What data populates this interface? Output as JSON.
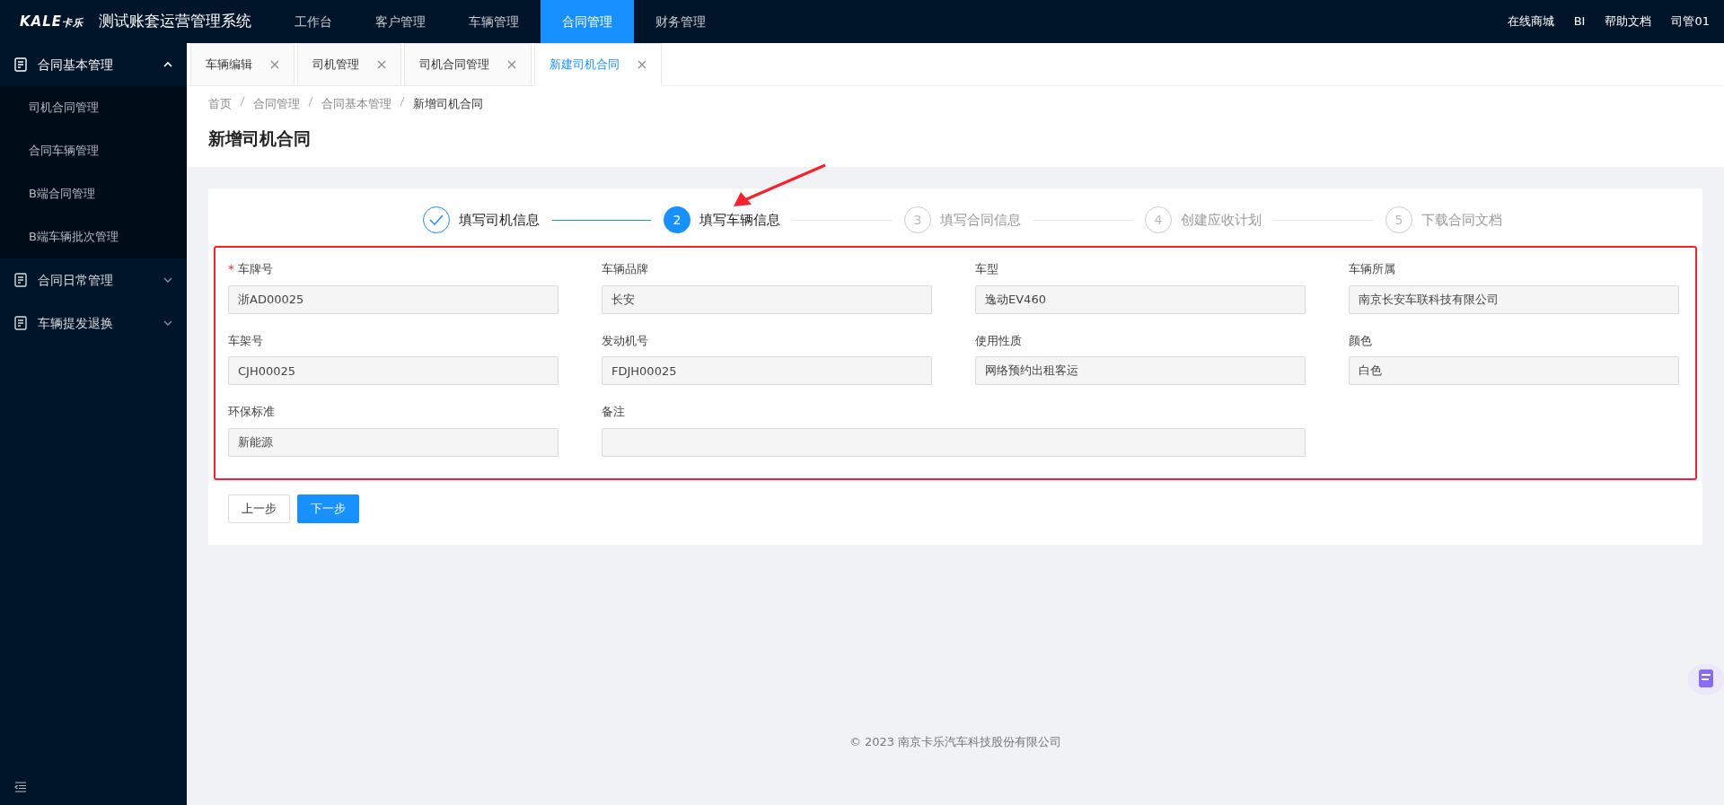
{
  "header": {
    "logo": {
      "latin": "KALE",
      "cjk": "卡乐"
    },
    "title": "测试账套运营管理系统",
    "nav": [
      {
        "label": "工作台",
        "selected": false
      },
      {
        "label": "客户管理",
        "selected": false
      },
      {
        "label": "车辆管理",
        "selected": false
      },
      {
        "label": "合同管理",
        "selected": true
      },
      {
        "label": "财务管理",
        "selected": false
      }
    ],
    "links": [
      "在线商城",
      "BI",
      "帮助文档",
      "司管01"
    ]
  },
  "sidebar": {
    "groups": [
      {
        "label": "合同基本管理",
        "expanded": true,
        "items": [
          {
            "label": "司机合同管理"
          },
          {
            "label": "合同车辆管理"
          },
          {
            "label": "B端合同管理"
          },
          {
            "label": "B端车辆批次管理"
          }
        ]
      },
      {
        "label": "合同日常管理",
        "expanded": false
      },
      {
        "label": "车辆提发退换",
        "expanded": false
      }
    ]
  },
  "tabs": [
    {
      "label": "车辆编辑",
      "selected": false
    },
    {
      "label": "司机管理",
      "selected": false
    },
    {
      "label": "司机合同管理",
      "selected": false
    },
    {
      "label": "新建司机合同",
      "selected": true
    }
  ],
  "breadcrumb": [
    "首页",
    "合同管理",
    "合同基本管理",
    "新增司机合同"
  ],
  "page_title": "新增司机合同",
  "steps": [
    {
      "label": "填写司机信息",
      "done": true,
      "selected": false
    },
    {
      "number": "2",
      "label": "填写车辆信息",
      "done": false,
      "selected": true
    },
    {
      "number": "3",
      "label": "填写合同信息",
      "done": false,
      "selected": false
    },
    {
      "number": "4",
      "label": "创建应收计划",
      "done": false,
      "selected": false
    },
    {
      "number": "5",
      "label": "下载合同文档",
      "done": false,
      "selected": false
    }
  ],
  "fields": [
    {
      "kind": "short",
      "marker": "*",
      "label": "车牌号",
      "value": "浙AD00025"
    },
    {
      "kind": "short",
      "label": "车辆品牌",
      "value": "长安"
    },
    {
      "kind": "short",
      "label": "车型",
      "value": "逸动EV460"
    },
    {
      "kind": "short",
      "label": "车辆所属",
      "value": "南京长安车联科技有限公司"
    },
    {
      "kind": "short",
      "label": "车架号",
      "value": "CJH00025"
    },
    {
      "kind": "short",
      "label": "发动机号",
      "value": "FDJH00025"
    },
    {
      "kind": "short",
      "label": "使用性质",
      "value": "网络预约出租客运"
    },
    {
      "kind": "short",
      "label": "颜色",
      "value": "白色"
    },
    {
      "kind": "short",
      "label": "环保标准",
      "value": "新能源"
    },
    {
      "kind": "long",
      "label": "备注"
    }
  ],
  "buttons": [
    {
      "label": "上一步",
      "kind": "default"
    },
    {
      "label": "下一步",
      "kind": "primary"
    }
  ],
  "footer": {
    "symbol": "©",
    "text": "2023 南京卡乐汽车科技股份有限公司"
  }
}
